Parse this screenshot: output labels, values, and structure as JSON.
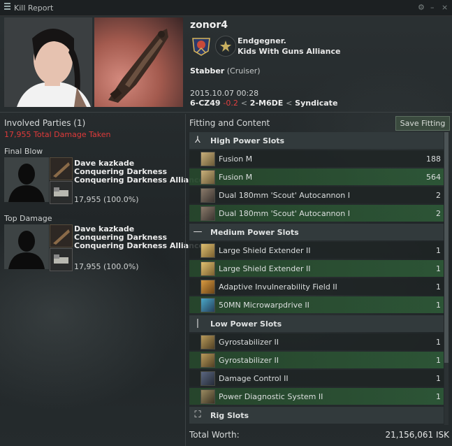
{
  "window": {
    "title": "Kill Report",
    "controls": [
      "⚙",
      "–",
      "×"
    ]
  },
  "victim": {
    "name": "zonor4",
    "corporation": "Endgegner.",
    "alliance": "Kids With Guns Alliance",
    "ship_name": "Stabber",
    "ship_class": "(Cruiser)",
    "datetime": "2015.10.07 00:28",
    "system": "6-CZ49",
    "security": "-0.2",
    "separator": "<",
    "region": "2-M6DE",
    "region_sep": "<",
    "constellation": "Syndicate"
  },
  "involved": {
    "heading": "Involved Parties (1)",
    "total_damage": "17,955 Total Damage Taken",
    "final_blow_label": "Final Blow",
    "top_damage_label": "Top Damage",
    "final_blow": {
      "name": "Dave kazkade",
      "corp": "Conquering Darkness",
      "alliance": "Conquering Darkness Alliance",
      "damage": "17,955 (100.0%)"
    },
    "top_damage": {
      "name": "Dave kazkade",
      "corp": "Conquering Darkness",
      "alliance": "Conquering Darkness Alliance",
      "damage": "17,955 (100.0%)"
    }
  },
  "fitting": {
    "heading": "Fitting and Content",
    "save_button": "Save Fitting",
    "high_label": "High Power Slots",
    "high": [
      {
        "name": "Fusion M",
        "qty": "188",
        "icon": "ammo-icon",
        "state": "dark"
      },
      {
        "name": "Fusion M",
        "qty": "564",
        "icon": "ammo-icon",
        "state": "green"
      },
      {
        "name": "Dual 180mm 'Scout' Autocannon I",
        "qty": "2",
        "icon": "autocannon-icon",
        "state": "dark"
      },
      {
        "name": "Dual 180mm 'Scout' Autocannon I",
        "qty": "2",
        "icon": "autocannon-icon",
        "state": "green"
      }
    ],
    "med_label": "Medium Power Slots",
    "med": [
      {
        "name": "Large Shield Extender II",
        "qty": "1",
        "icon": "shield-extender-icon",
        "state": "dark"
      },
      {
        "name": "Large Shield Extender II",
        "qty": "1",
        "icon": "shield-extender-icon",
        "state": "green"
      },
      {
        "name": "Adaptive Invulnerability Field II",
        "qty": "1",
        "icon": "invuln-field-icon",
        "state": "dark"
      },
      {
        "name": "50MN Microwarpdrive II",
        "qty": "1",
        "icon": "microwarpdrive-icon",
        "state": "green"
      }
    ],
    "low_label": "Low Power Slots",
    "low": [
      {
        "name": "Gyrostabilizer II",
        "qty": "1",
        "icon": "gyrostabilizer-icon",
        "state": "dark"
      },
      {
        "name": "Gyrostabilizer II",
        "qty": "1",
        "icon": "gyrostabilizer-icon",
        "state": "green"
      },
      {
        "name": "Damage Control II",
        "qty": "1",
        "icon": "damage-control-icon",
        "state": "dark"
      },
      {
        "name": "Power Diagnostic System II",
        "qty": "1",
        "icon": "power-diagnostic-icon",
        "state": "green"
      }
    ],
    "rig_label": "Rig Slots"
  },
  "total": {
    "label": "Total Worth:",
    "value": "21,156,061 ISK"
  },
  "colors": {
    "security_negative": "#e04040",
    "damage_red": "#e03a3a",
    "dropped_row": "#2e5c38",
    "destroyed_row": "#1e2424"
  }
}
